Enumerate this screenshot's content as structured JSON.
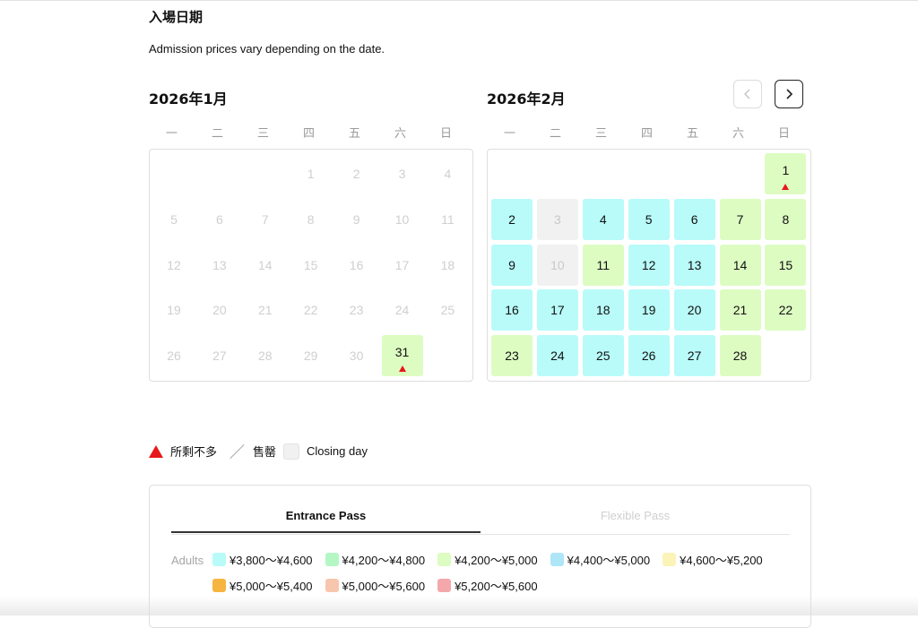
{
  "page": {
    "title": "入場日期",
    "subtitle": "Admission prices vary depending on the date."
  },
  "weekdays": [
    "一",
    "二",
    "三",
    "四",
    "五",
    "六",
    "日"
  ],
  "calendars": [
    {
      "title": "2026年1月",
      "days": [
        {
          "day": "1",
          "state": "muted"
        },
        {
          "day": "2",
          "state": "muted"
        },
        {
          "day": "3",
          "state": "muted"
        },
        {
          "day": "4",
          "state": "muted"
        },
        {
          "day": "5",
          "state": "muted"
        },
        {
          "day": "6",
          "state": "muted"
        },
        {
          "day": "7",
          "state": "muted"
        },
        {
          "day": "8",
          "state": "muted"
        },
        {
          "day": "9",
          "state": "muted"
        },
        {
          "day": "10",
          "state": "muted"
        },
        {
          "day": "11",
          "state": "muted"
        },
        {
          "day": "12",
          "state": "muted"
        },
        {
          "day": "13",
          "state": "muted"
        },
        {
          "day": "14",
          "state": "muted"
        },
        {
          "day": "15",
          "state": "muted"
        },
        {
          "day": "16",
          "state": "muted"
        },
        {
          "day": "17",
          "state": "muted"
        },
        {
          "day": "18",
          "state": "muted"
        },
        {
          "day": "19",
          "state": "muted"
        },
        {
          "day": "20",
          "state": "muted"
        },
        {
          "day": "21",
          "state": "muted"
        },
        {
          "day": "22",
          "state": "muted"
        },
        {
          "day": "23",
          "state": "muted"
        },
        {
          "day": "24",
          "state": "muted"
        },
        {
          "day": "25",
          "state": "muted"
        },
        {
          "day": "26",
          "state": "muted"
        },
        {
          "day": "27",
          "state": "muted"
        },
        {
          "day": "28",
          "state": "muted"
        },
        {
          "day": "29",
          "state": "muted"
        },
        {
          "day": "30",
          "state": "muted"
        },
        {
          "day": "31",
          "state": "green",
          "few_left": true
        }
      ]
    },
    {
      "title": "2026年2月",
      "days": [
        {
          "day": "1",
          "state": "green",
          "few_left": true
        },
        {
          "day": "2",
          "state": "cyan"
        },
        {
          "day": "3",
          "state": "closed"
        },
        {
          "day": "4",
          "state": "cyan"
        },
        {
          "day": "5",
          "state": "cyan"
        },
        {
          "day": "6",
          "state": "cyan"
        },
        {
          "day": "7",
          "state": "green"
        },
        {
          "day": "8",
          "state": "green"
        },
        {
          "day": "9",
          "state": "cyan"
        },
        {
          "day": "10",
          "state": "closed"
        },
        {
          "day": "11",
          "state": "green"
        },
        {
          "day": "12",
          "state": "cyan"
        },
        {
          "day": "13",
          "state": "cyan"
        },
        {
          "day": "14",
          "state": "green"
        },
        {
          "day": "15",
          "state": "green"
        },
        {
          "day": "16",
          "state": "cyan"
        },
        {
          "day": "17",
          "state": "cyan"
        },
        {
          "day": "18",
          "state": "cyan"
        },
        {
          "day": "19",
          "state": "cyan"
        },
        {
          "day": "20",
          "state": "cyan"
        },
        {
          "day": "21",
          "state": "green"
        },
        {
          "day": "22",
          "state": "green"
        },
        {
          "day": "23",
          "state": "green"
        },
        {
          "day": "24",
          "state": "cyan"
        },
        {
          "day": "25",
          "state": "cyan"
        },
        {
          "day": "26",
          "state": "cyan"
        },
        {
          "day": "27",
          "state": "cyan"
        },
        {
          "day": "28",
          "state": "green"
        }
      ]
    }
  ],
  "legend": {
    "few_left": "所剩不多",
    "sold_out": "售罄",
    "closing_day": "Closing day"
  },
  "prices": {
    "tabs": [
      {
        "label": "Entrance Pass",
        "active": true
      },
      {
        "label": "Flexible Pass",
        "active": false
      }
    ],
    "adults_label": "Adults",
    "items": [
      {
        "label": "¥3,800〜¥4,600",
        "color": "#b8fbf9"
      },
      {
        "label": "¥4,200〜¥4,800",
        "color": "#b4f7c4"
      },
      {
        "label": "¥4,200〜¥5,000",
        "color": "#ddfcc2"
      },
      {
        "label": "¥4,400〜¥5,000",
        "color": "#aee6f7"
      },
      {
        "label": "¥4,600〜¥5,200",
        "color": "#fbf3b8"
      },
      {
        "label": "¥5,000〜¥5,400",
        "color": "#f5b540"
      },
      {
        "label": "¥5,000〜¥5,600",
        "color": "#f6c7ad"
      },
      {
        "label": "¥5,200〜¥5,600",
        "color": "#f4a8ac"
      }
    ]
  },
  "colors": {
    "cyan": "#b8fbf9",
    "green": "#ddfcc2",
    "closed": "#f1f1f1",
    "few_left_marker": "#e8171b"
  }
}
